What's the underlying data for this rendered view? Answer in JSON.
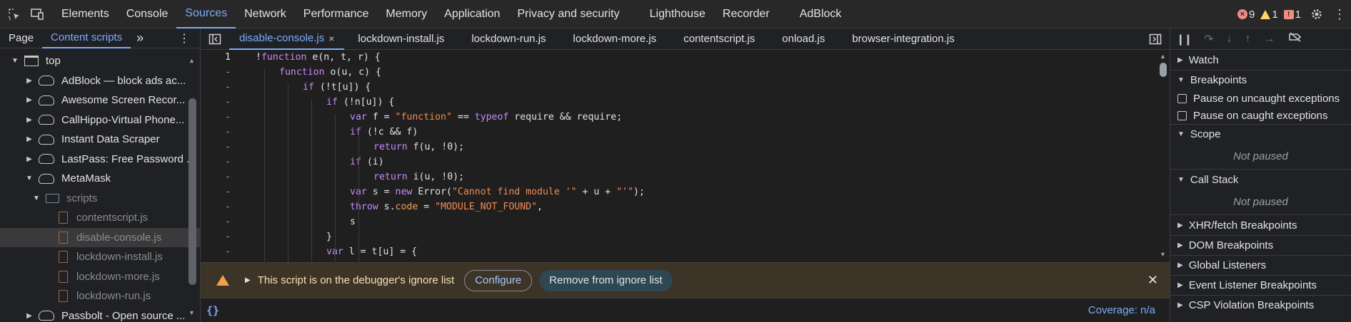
{
  "toolbar": {
    "tabs": [
      "Elements",
      "Console",
      "Sources",
      "Network",
      "Performance",
      "Memory",
      "Application",
      "Privacy and security",
      "Lighthouse",
      "Recorder",
      "AdBlock"
    ],
    "active_tab": "Sources",
    "errors": "9",
    "warnings": "1",
    "issues": "1"
  },
  "left_panel": {
    "tabs": [
      "Page",
      "Content scripts"
    ],
    "more": "»",
    "tree": [
      {
        "label": "top",
        "kind": "window",
        "depth": 0,
        "arrow": "open"
      },
      {
        "label": "AdBlock — block ads ac...",
        "kind": "cloud",
        "depth": 1,
        "arrow": "closed"
      },
      {
        "label": "Awesome Screen Recor...",
        "kind": "cloud",
        "depth": 1,
        "arrow": "closed"
      },
      {
        "label": "CallHippo-Virtual Phone...",
        "kind": "cloud",
        "depth": 1,
        "arrow": "closed"
      },
      {
        "label": "Instant Data Scraper",
        "kind": "cloud",
        "depth": 1,
        "arrow": "closed"
      },
      {
        "label": "LastPass: Free Password ...",
        "kind": "cloud",
        "depth": 1,
        "arrow": "closed"
      },
      {
        "label": "MetaMask",
        "kind": "cloud",
        "depth": 1,
        "arrow": "open"
      },
      {
        "label": "scripts",
        "kind": "folder",
        "depth": 2,
        "arrow": "open"
      },
      {
        "label": "contentscript.js",
        "kind": "file",
        "depth": 3,
        "arrow": ""
      },
      {
        "label": "disable-console.js",
        "kind": "file",
        "depth": 3,
        "arrow": "",
        "selected": true
      },
      {
        "label": "lockdown-install.js",
        "kind": "file",
        "depth": 3,
        "arrow": ""
      },
      {
        "label": "lockdown-more.js",
        "kind": "file",
        "depth": 3,
        "arrow": ""
      },
      {
        "label": "lockdown-run.js",
        "kind": "file",
        "depth": 3,
        "arrow": ""
      },
      {
        "label": "Passbolt - Open source ...",
        "kind": "cloud",
        "depth": 1,
        "arrow": "closed"
      }
    ]
  },
  "editor": {
    "file_tabs": [
      "disable-console.js",
      "lockdown-install.js",
      "lockdown-run.js",
      "lockdown-more.js",
      "contentscript.js",
      "onload.js",
      "browser-integration.js"
    ],
    "active_file": "disable-console.js",
    "close_glyph": "×",
    "lines": [
      {
        "num": "1",
        "indent": 0,
        "html": "!<span class='kw'>function</span> e(n, t, r) {"
      },
      {
        "num": "-",
        "indent": 1,
        "html": "<span class='kw'>function</span> o(u, c) {"
      },
      {
        "num": "-",
        "indent": 2,
        "html": "<span class='kw'>if</span> (!t[u]) {"
      },
      {
        "num": "-",
        "indent": 3,
        "html": "<span class='kw'>if</span> (!n[u]) {"
      },
      {
        "num": "-",
        "indent": 4,
        "html": "<span class='kw'>var</span> f = <span class='str'>\"function\"</span> == <span class='kw'>typeof</span> require &amp;&amp; require;"
      },
      {
        "num": "-",
        "indent": 4,
        "html": "<span class='kw'>if</span> (!c &amp;&amp; f)"
      },
      {
        "num": "-",
        "indent": 5,
        "html": "<span class='kw'>return</span> f(u, !0);"
      },
      {
        "num": "-",
        "indent": 4,
        "html": "<span class='kw'>if</span> (i)"
      },
      {
        "num": "-",
        "indent": 5,
        "html": "<span class='kw'>return</span> i(u, !0);"
      },
      {
        "num": "-",
        "indent": 4,
        "html": "<span class='kw'>var</span> s = <span class='kw'>new</span> Error(<span class='str'>\"Cannot find module '\"</span> + u + <span class='str'>\"'\"</span>);"
      },
      {
        "num": "-",
        "indent": 4,
        "html": "<span class='kw'>throw</span> s.<span class='prop'>code</span> = <span class='str'>\"MODULE_NOT_FOUND\"</span>,"
      },
      {
        "num": "-",
        "indent": 4,
        "html": "s"
      },
      {
        "num": "-",
        "indent": 3,
        "html": "}"
      },
      {
        "num": "-",
        "indent": 3,
        "html": "<span class='kw'>var</span> l = t[u] = {"
      }
    ],
    "banner_text": "This script is on the debugger's ignore list",
    "configure_label": "Configure",
    "remove_label": "Remove from ignore list",
    "pretty_print": "{}",
    "coverage": "Coverage: n/a"
  },
  "right_panel": {
    "watch": "Watch",
    "breakpoints": "Breakpoints",
    "pause_uncaught": "Pause on uncaught exceptions",
    "pause_caught": "Pause on caught exceptions",
    "scope": "Scope",
    "scope_status": "Not paused",
    "call_stack": "Call Stack",
    "call_stack_status": "Not paused",
    "sections": [
      "XHR/fetch Breakpoints",
      "DOM Breakpoints",
      "Global Listeners",
      "Event Listener Breakpoints",
      "CSP Violation Breakpoints"
    ]
  }
}
